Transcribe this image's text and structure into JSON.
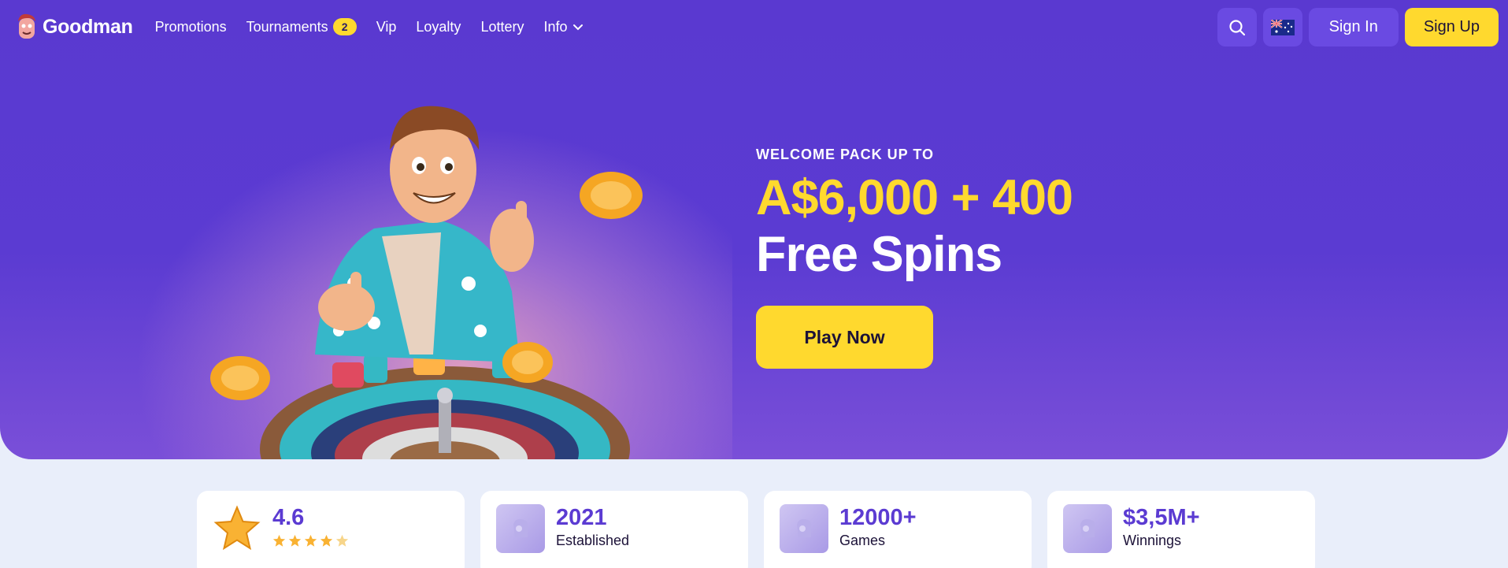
{
  "brand": {
    "name": "Goodman"
  },
  "nav": {
    "items": [
      {
        "label": "Promotions"
      },
      {
        "label": "Tournaments",
        "badge": "2"
      },
      {
        "label": "Vip"
      },
      {
        "label": "Loyalty"
      },
      {
        "label": "Lottery"
      },
      {
        "label": "Info"
      }
    ],
    "search_icon": "search-icon",
    "flag_icon": "australia-flag-icon",
    "signin_label": "Sign In",
    "signup_label": "Sign Up"
  },
  "hero": {
    "welcome": "WELCOME PACK UP TO",
    "amount": "A$6,000 + 400",
    "spins": "Free Spins",
    "cta": "Play Now"
  },
  "stats": [
    {
      "value": "4.6",
      "label": "",
      "icon": "star-icon",
      "rating": 4.6
    },
    {
      "value": "2021",
      "label": "Established",
      "icon": "goodman-thumb-icon"
    },
    {
      "value": "12000+",
      "label": "Games",
      "icon": "goodman-thumb-icon"
    },
    {
      "value": "$3,5M+",
      "label": "Winnings",
      "icon": "goodman-thumb-icon"
    }
  ],
  "colors": {
    "primary": "#5b3bd2",
    "accent": "#ffd92e",
    "background": "#e9eefa"
  }
}
